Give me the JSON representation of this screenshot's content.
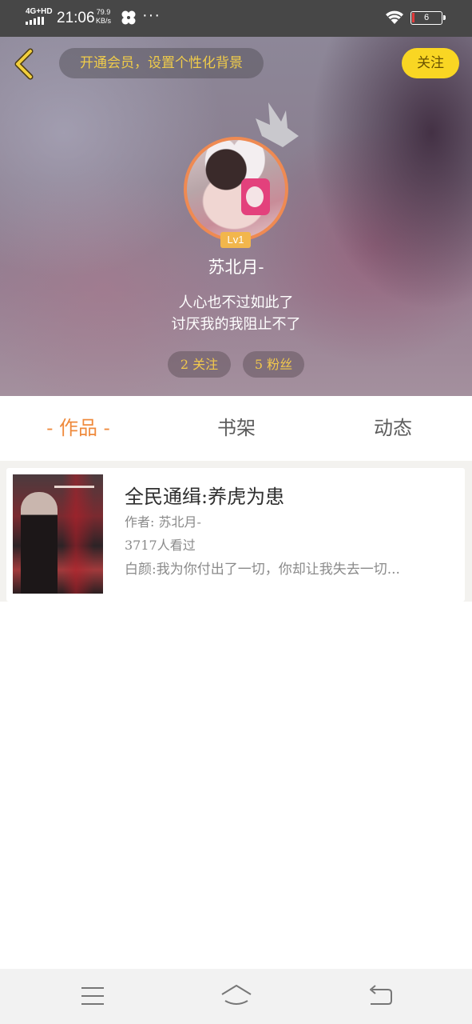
{
  "status_bar": {
    "network": "4G+HD",
    "time": "21:06",
    "speed_value": "79.9",
    "speed_unit": "KB/s",
    "more_indicator": "···",
    "battery_level": "6",
    "icons": [
      "signal-icon",
      "fan-icon",
      "wifi-icon",
      "battery-icon"
    ],
    "battery_low_color": "#e23b3b"
  },
  "header": {
    "back_icon": "chevron-left-icon",
    "vip_text": "开通会员，设置个性化背景",
    "follow_label": "关注",
    "level": "Lv1",
    "username": "苏北月-",
    "bio_line1": "人心也不过如此了",
    "bio_line2": "讨厌我的我阻止不了",
    "following_label": "2 关注",
    "fans_label": "5 粉丝",
    "accent_color": "#f9d623",
    "avatar_border_color": "#ef8a52"
  },
  "tabs": [
    {
      "label": "- 作品 -",
      "active": true
    },
    {
      "label": "书架",
      "active": false
    },
    {
      "label": "动态",
      "active": false
    }
  ],
  "tab_active_color": "#ef8a3c",
  "works": [
    {
      "title": "全民通缉:养虎为患",
      "author": "作者: 苏北月-",
      "readers": "3717人看过",
      "intro": "白颜:我为你付出了一切，你却让我失去一切..."
    }
  ],
  "nav_bar": {
    "icons": [
      "menu-icon",
      "home-icon",
      "back-icon"
    ]
  }
}
